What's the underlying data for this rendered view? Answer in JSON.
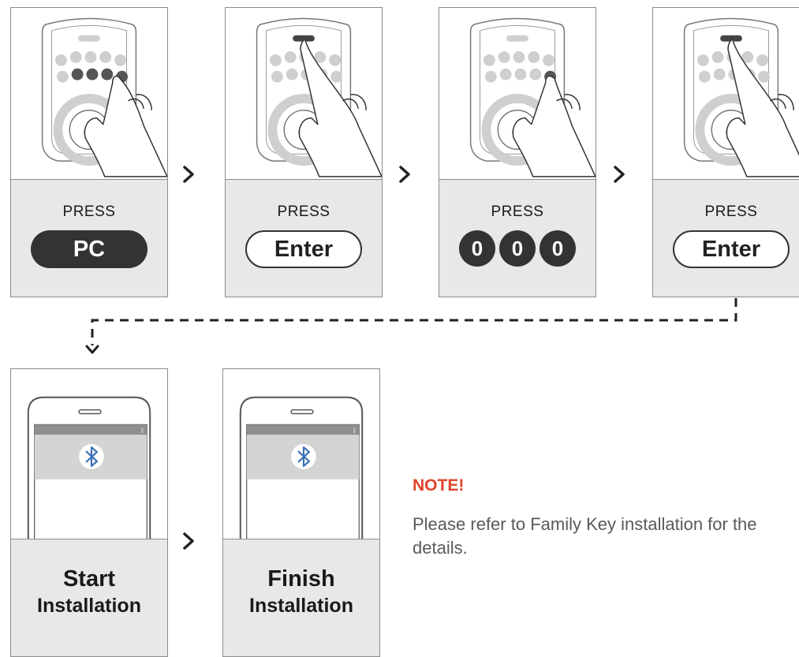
{
  "steps": [
    {
      "label": "PRESS",
      "key": "PC",
      "style": "dark",
      "highlight": "pc"
    },
    {
      "label": "PRESS",
      "key": "Enter",
      "style": "light",
      "highlight": "enter"
    },
    {
      "label": "PRESS",
      "digits": [
        "0",
        "0",
        "0"
      ],
      "highlight": "zero"
    },
    {
      "label": "PRESS",
      "key": "Enter",
      "style": "light",
      "highlight": "enter"
    }
  ],
  "install": [
    {
      "title_line1": "Start",
      "title_line2": "Installation"
    },
    {
      "title_line1": "Finish",
      "title_line2": "Installation"
    }
  ],
  "note": {
    "title": "NOTE!",
    "body": "Please refer to Family Key installation for the details."
  },
  "colors": {
    "accent": "#e0432b",
    "dark": "#333333",
    "panel": "#e8e8e8",
    "bluetooth": "#3a6fb5"
  },
  "icons": [
    "chevron-right-icon",
    "hand-press-icon",
    "bluetooth-icon",
    "dashed-down-arrow-icon"
  ]
}
